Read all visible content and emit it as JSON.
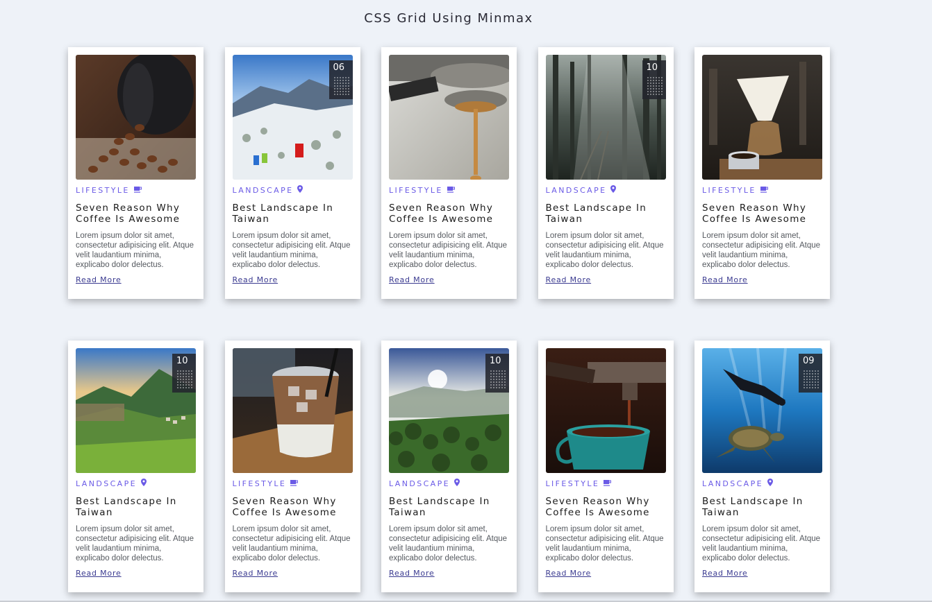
{
  "page": {
    "title": "CSS Grid Using Minmax"
  },
  "colors": {
    "background": "#eef2f8",
    "accent": "#6a5ae6",
    "link": "#3a3a90"
  },
  "cards": [
    {
      "category": "LIFESTYLE",
      "category_icon": "coffee-cup-icon",
      "title_line1": "Seven Reason Why",
      "title_line2": "Coffee Is Awesome",
      "excerpt": "Lorem ipsum dolor sit amet, consectetur adipisicing elit. Atque velit laudantium minima, explicabo dolor delectus.",
      "link": "Read More",
      "image": "coffee-beans-image"
    },
    {
      "category": "LANDSCAPE",
      "category_icon": "map-pin-icon",
      "title_line1": "Best Landscape In",
      "title_line2": "Taiwan",
      "excerpt": "Lorem ipsum dolor sit amet, consectetur adipisicing elit. Atque velit laudantium minima, explicabo dolor delectus.",
      "link": "Read More",
      "image": "snowy-mountain-image",
      "date_badge": "06"
    },
    {
      "category": "LIFESTYLE",
      "category_icon": "coffee-cup-icon",
      "title_line1": "Seven Reason Why",
      "title_line2": "Coffee Is Awesome",
      "excerpt": "Lorem ipsum dolor sit amet, consectetur adipisicing elit. Atque velit laudantium minima, explicabo dolor delectus.",
      "link": "Read More",
      "image": "espresso-machine-image"
    },
    {
      "category": "LANDSCAPE",
      "category_icon": "map-pin-icon",
      "title_line1": "Best Landscape In",
      "title_line2": "Taiwan",
      "excerpt": "Lorem ipsum dolor sit amet, consectetur adipisicing elit. Atque velit laudantium minima, explicabo dolor delectus.",
      "link": "Read More",
      "image": "forest-railway-image",
      "date_badge": "10"
    },
    {
      "category": "LIFESTYLE",
      "category_icon": "coffee-cup-icon",
      "title_line1": "Seven Reason Why",
      "title_line2": "Coffee Is Awesome",
      "excerpt": "Lorem ipsum dolor sit amet, consectetur adipisicing elit. Atque velit laudantium minima, explicabo dolor delectus.",
      "link": "Read More",
      "image": "pour-over-coffee-image"
    },
    {
      "category": "LANDSCAPE",
      "category_icon": "map-pin-icon",
      "title_line1": "Best Landscape In",
      "title_line2": "Taiwan",
      "excerpt": "Lorem ipsum dolor sit amet, consectetur adipisicing elit. Atque velit laudantium minima, explicabo dolor delectus.",
      "link": "Read More",
      "image": "green-terrace-mountain-image",
      "date_badge": "10"
    },
    {
      "category": "LIFESTYLE",
      "category_icon": "coffee-cup-icon",
      "title_line1": "Seven Reason Why",
      "title_line2": "Coffee Is Awesome",
      "excerpt": "Lorem ipsum dolor sit amet, consectetur adipisicing elit. Atque velit laudantium minima, explicabo dolor delectus.",
      "link": "Read More",
      "image": "iced-coffee-image"
    },
    {
      "category": "LANDSCAPE",
      "category_icon": "map-pin-icon",
      "title_line1": "Best Landscape In",
      "title_line2": "Taiwan",
      "excerpt": "Lorem ipsum dolor sit amet, consectetur adipisicing elit. Atque velit laudantium minima, explicabo dolor delectus.",
      "link": "Read More",
      "image": "sunrise-valley-image",
      "date_badge": "10"
    },
    {
      "category": "LIFESTYLE",
      "category_icon": "coffee-cup-icon",
      "title_line1": "Seven Reason Why",
      "title_line2": "Coffee Is Awesome",
      "excerpt": "Lorem ipsum dolor sit amet, consectetur adipisicing elit. Atque velit laudantium minima, explicabo dolor delectus.",
      "link": "Read More",
      "image": "espresso-cup-image"
    },
    {
      "category": "LANDSCAPE",
      "category_icon": "map-pin-icon",
      "title_line1": "Best Landscape In",
      "title_line2": "Taiwan",
      "excerpt": "Lorem ipsum dolor sit amet, consectetur adipisicing elit. Atque velit laudantium minima, explicabo dolor delectus.",
      "link": "Read More",
      "image": "diver-turtle-image",
      "date_badge": "09"
    }
  ]
}
